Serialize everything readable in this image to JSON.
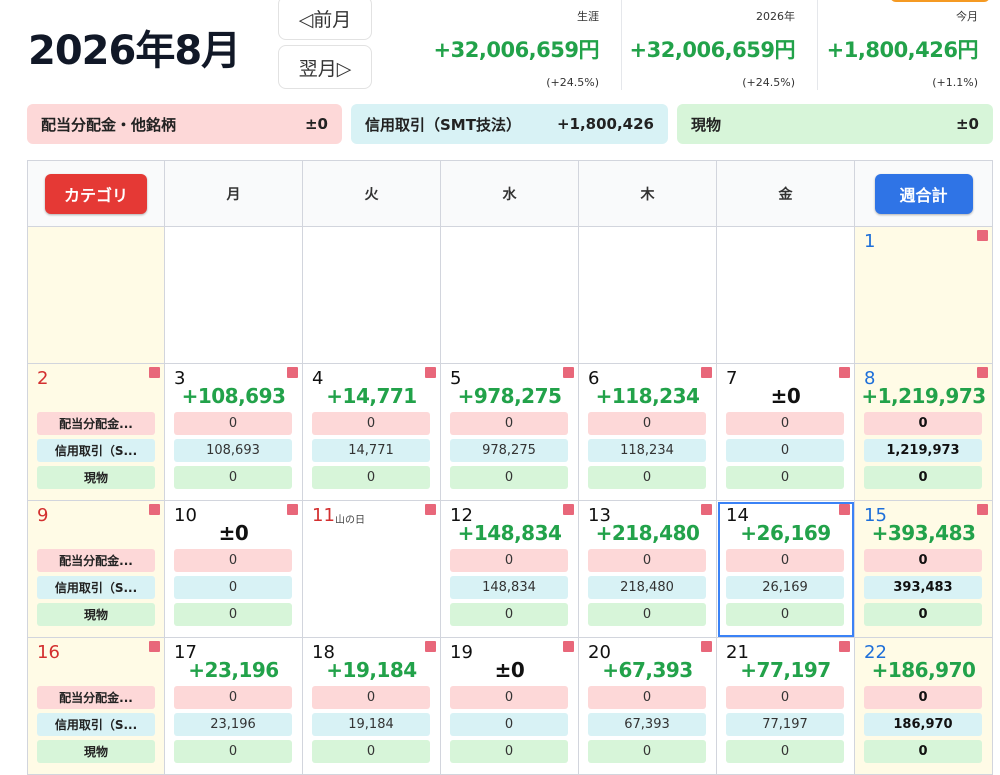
{
  "header": {
    "month_title": "2026年8月",
    "prev_label": "◁前月",
    "next_label": "翌月▷",
    "stats": [
      {
        "label": "生涯",
        "value": "+32,006,659円",
        "pct": "(+24.5%)"
      },
      {
        "label": "2026年",
        "value": "+32,006,659円",
        "pct": "(+24.5%)"
      },
      {
        "label": "今月",
        "value": "+1,800,426円",
        "pct": "(+1.1%)"
      }
    ]
  },
  "categories": [
    {
      "name": "配当分配金・他銘柄",
      "value": "±0"
    },
    {
      "name": "信用取引（SMT技法）",
      "value": "+1,800,426"
    },
    {
      "name": "現物",
      "value": "±0"
    }
  ],
  "calendar": {
    "category_button": "カテゴリ",
    "week_total_button": "週合計",
    "weekdays": [
      "月",
      "火",
      "水",
      "木",
      "金"
    ],
    "row_labels": [
      "配当分配金...",
      "信用取引（S...",
      "現物"
    ],
    "first_week_sunday": {
      "day": "1"
    },
    "weeks": [
      {
        "sunday": {
          "day": "2"
        },
        "days": [
          {
            "day": "3",
            "total": "+108,693",
            "v1": "0",
            "v2": "108,693",
            "v3": "0"
          },
          {
            "day": "4",
            "total": "+14,771",
            "v1": "0",
            "v2": "14,771",
            "v3": "0"
          },
          {
            "day": "5",
            "total": "+978,275",
            "v1": "0",
            "v2": "978,275",
            "v3": "0"
          },
          {
            "day": "6",
            "total": "+118,234",
            "v1": "0",
            "v2": "118,234",
            "v3": "0"
          },
          {
            "day": "7",
            "total": "±0",
            "v1": "0",
            "v2": "0",
            "v3": "0"
          }
        ],
        "saturday": {
          "day": "8",
          "total": "+1,219,973",
          "v1": "0",
          "v2": "1,219,973",
          "v3": "0"
        }
      },
      {
        "sunday": {
          "day": "9"
        },
        "days": [
          {
            "day": "10",
            "total": "±0",
            "v1": "0",
            "v2": "0",
            "v3": "0"
          },
          {
            "day": "11",
            "holiday": "山の日"
          },
          {
            "day": "12",
            "total": "+148,834",
            "v1": "0",
            "v2": "148,834",
            "v3": "0"
          },
          {
            "day": "13",
            "total": "+218,480",
            "v1": "0",
            "v2": "218,480",
            "v3": "0"
          },
          {
            "day": "14",
            "total": "+26,169",
            "v1": "0",
            "v2": "26,169",
            "v3": "0"
          }
        ],
        "saturday": {
          "day": "15",
          "total": "+393,483",
          "v1": "0",
          "v2": "393,483",
          "v3": "0"
        }
      },
      {
        "sunday": {
          "day": "16"
        },
        "days": [
          {
            "day": "17",
            "total": "+23,196",
            "v1": "0",
            "v2": "23,196",
            "v3": "0"
          },
          {
            "day": "18",
            "total": "+19,184",
            "v1": "0",
            "v2": "19,184",
            "v3": "0"
          },
          {
            "day": "19",
            "total": "±0",
            "v1": "0",
            "v2": "0",
            "v3": "0"
          },
          {
            "day": "20",
            "total": "+67,393",
            "v1": "0",
            "v2": "67,393",
            "v3": "0"
          },
          {
            "day": "21",
            "total": "+77,197",
            "v1": "0",
            "v2": "77,197",
            "v3": "0"
          }
        ],
        "saturday": {
          "day": "22",
          "total": "+186,970",
          "v1": "0",
          "v2": "186,970",
          "v3": "0"
        }
      }
    ]
  },
  "colors": {
    "positive": "#22a24a",
    "sunday": "#d32f2f",
    "saturday": "#1e6fd9",
    "category_button": "#e53935",
    "week_total_button": "#2f74e6",
    "flag": "#e8677a"
  }
}
